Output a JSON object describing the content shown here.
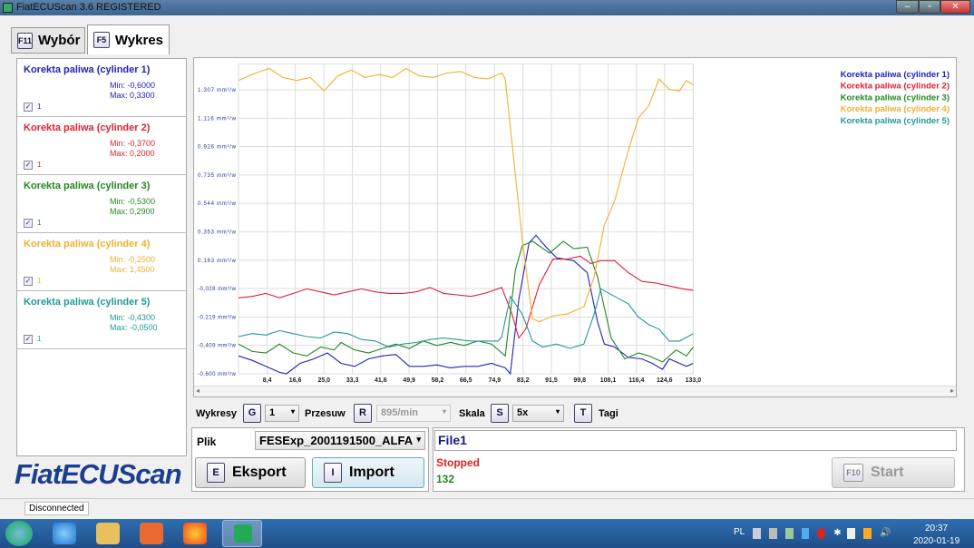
{
  "window": {
    "title": "FiatECUScan 3.6 REGISTERED"
  },
  "tabs": [
    {
      "key": "F11",
      "label": "Wybór"
    },
    {
      "key": "F5",
      "label": "Wykres"
    }
  ],
  "channels": [
    {
      "name": "Korekta paliwa (cylinder 1)",
      "min": "Min: -0,6000",
      "max": "Max: 0,3300",
      "value": "1",
      "checked": true,
      "color": "#2222bb"
    },
    {
      "name": "Korekta paliwa (cylinder 2)",
      "min": "Min: -0,3700",
      "max": "Max: 0,2000",
      "value": "1",
      "checked": true,
      "color": "#dd2233"
    },
    {
      "name": "Korekta paliwa (cylinder 3)",
      "min": "Min: -0,5300",
      "max": "Max: 0,2900",
      "value": "1",
      "checked": true,
      "color": "#228822"
    },
    {
      "name": "Korekta paliwa (cylinder 4)",
      "min": "Min: -0,2500",
      "max": "Max: 1,4500",
      "value": "1",
      "checked": true,
      "color": "#f0b030"
    },
    {
      "name": "Korekta paliwa (cylinder 5)",
      "min": "Min: -0,4300",
      "max": "Max: -0,0500",
      "value": "1",
      "checked": true,
      "color": "#229999"
    }
  ],
  "chart_data": {
    "type": "line",
    "xlim": [
      0,
      133
    ],
    "ylim": [
      -0.6,
      1.48
    ],
    "yticks": [
      1.307,
      1.116,
      0.926,
      0.735,
      0.544,
      0.353,
      0.163,
      -0.028,
      -0.219,
      -0.409,
      -0.6
    ],
    "ytick_labels": [
      "1,307 mm³/w",
      "1,116 mm³/w",
      "0,926 mm³/w",
      "0,735 mm³/w",
      "0,544 mm³/w",
      "0,353 mm³/w",
      "0,163 mm³/w",
      "-0,028 mm³/w",
      "-0,219 mm³/w",
      "-0,409 mm³/w",
      "-0,600 mm³/w"
    ],
    "xticks": [
      8.4,
      16.6,
      25.0,
      33.3,
      41.6,
      49.9,
      58.2,
      66.5,
      74.9,
      83.2,
      91.5,
      99.8,
      108.1,
      116.4,
      124.6,
      133.0
    ],
    "xtick_labels": [
      "8,4",
      "16,6",
      "25,0",
      "33,3",
      "41,6",
      "49,9",
      "58,2",
      "66,5",
      "74,9",
      "83,2",
      "91,5",
      "99,8",
      "108,1",
      "116,4",
      "124,6",
      "133,0"
    ],
    "grid": true,
    "legend": "top-right",
    "series": [
      {
        "name": "Korekta paliwa (cylinder 1)",
        "color": "#2222bb",
        "points": [
          [
            0,
            -0.48
          ],
          [
            4,
            -0.51
          ],
          [
            8,
            -0.55
          ],
          [
            12,
            -0.59
          ],
          [
            14,
            -0.6
          ],
          [
            18,
            -0.53
          ],
          [
            22,
            -0.5
          ],
          [
            26,
            -0.46
          ],
          [
            30,
            -0.53
          ],
          [
            34,
            -0.55
          ],
          [
            38,
            -0.5
          ],
          [
            42,
            -0.48
          ],
          [
            46,
            -0.47
          ],
          [
            50,
            -0.55
          ],
          [
            54,
            -0.55
          ],
          [
            58,
            -0.54
          ],
          [
            62,
            -0.56
          ],
          [
            66,
            -0.55
          ],
          [
            70,
            -0.55
          ],
          [
            74,
            -0.53
          ],
          [
            78,
            -0.56
          ],
          [
            79.5,
            -0.6
          ],
          [
            82,
            -0.1
          ],
          [
            85,
            0.28
          ],
          [
            87,
            0.33
          ],
          [
            90,
            0.25
          ],
          [
            93,
            0.18
          ],
          [
            98,
            0.16
          ],
          [
            102,
            0.08
          ],
          [
            105,
            -0.25
          ],
          [
            107,
            -0.4
          ],
          [
            110,
            -0.42
          ],
          [
            114,
            -0.49
          ],
          [
            118,
            -0.5
          ],
          [
            121,
            -0.53
          ],
          [
            124,
            -0.57
          ],
          [
            126,
            -0.5
          ],
          [
            129,
            -0.53
          ],
          [
            131,
            -0.55
          ],
          [
            133,
            -0.53
          ]
        ]
      },
      {
        "name": "Korekta paliwa (cylinder 2)",
        "color": "#dd2233",
        "points": [
          [
            0,
            -0.09
          ],
          [
            4,
            -0.08
          ],
          [
            8,
            -0.06
          ],
          [
            12,
            -0.09
          ],
          [
            16,
            -0.06
          ],
          [
            20,
            -0.03
          ],
          [
            24,
            -0.05
          ],
          [
            28,
            -0.07
          ],
          [
            32,
            -0.05
          ],
          [
            36,
            -0.03
          ],
          [
            40,
            -0.05
          ],
          [
            44,
            -0.06
          ],
          [
            48,
            -0.06
          ],
          [
            52,
            -0.05
          ],
          [
            56,
            -0.02
          ],
          [
            60,
            -0.06
          ],
          [
            64,
            -0.07
          ],
          [
            68,
            -0.08
          ],
          [
            72,
            -0.06
          ],
          [
            77,
            -0.02
          ],
          [
            80,
            -0.2
          ],
          [
            82,
            -0.36
          ],
          [
            84,
            -0.3
          ],
          [
            88,
            0.0
          ],
          [
            92,
            0.17
          ],
          [
            96,
            0.17
          ],
          [
            100,
            0.19
          ],
          [
            103,
            0.14
          ],
          [
            106,
            0.16
          ],
          [
            110,
            0.16
          ],
          [
            114,
            0.08
          ],
          [
            118,
            0.02
          ],
          [
            122,
            0.01
          ],
          [
            126,
            -0.01
          ],
          [
            130,
            -0.03
          ],
          [
            133,
            -0.04
          ]
        ]
      },
      {
        "name": "Korekta paliwa (cylinder 3)",
        "color": "#228822",
        "points": [
          [
            0,
            -0.4
          ],
          [
            4,
            -0.45
          ],
          [
            8,
            -0.46
          ],
          [
            12,
            -0.4
          ],
          [
            16,
            -0.46
          ],
          [
            20,
            -0.48
          ],
          [
            24,
            -0.42
          ],
          [
            28,
            -0.44
          ],
          [
            30,
            -0.39
          ],
          [
            34,
            -0.44
          ],
          [
            38,
            -0.46
          ],
          [
            42,
            -0.43
          ],
          [
            46,
            -0.4
          ],
          [
            50,
            -0.43
          ],
          [
            54,
            -0.38
          ],
          [
            58,
            -0.41
          ],
          [
            62,
            -0.39
          ],
          [
            66,
            -0.41
          ],
          [
            70,
            -0.38
          ],
          [
            74,
            -0.4
          ],
          [
            78,
            -0.48
          ],
          [
            81,
            0.1
          ],
          [
            83,
            0.26
          ],
          [
            86,
            0.29
          ],
          [
            91,
            0.21
          ],
          [
            95,
            0.29
          ],
          [
            98,
            0.24
          ],
          [
            102,
            0.25
          ],
          [
            105,
            0.05
          ],
          [
            109,
            -0.36
          ],
          [
            113,
            -0.5
          ],
          [
            117,
            -0.46
          ],
          [
            120,
            -0.48
          ],
          [
            124,
            -0.52
          ],
          [
            128,
            -0.44
          ],
          [
            131,
            -0.48
          ],
          [
            133,
            -0.42
          ]
        ]
      },
      {
        "name": "Korekta paliwa (cylinder 4)",
        "color": "#f0b030",
        "points": [
          [
            0,
            1.37
          ],
          [
            5,
            1.42
          ],
          [
            9,
            1.45
          ],
          [
            13,
            1.39
          ],
          [
            17,
            1.37
          ],
          [
            21,
            1.39
          ],
          [
            25,
            1.3
          ],
          [
            29,
            1.4
          ],
          [
            33,
            1.44
          ],
          [
            37,
            1.39
          ],
          [
            41,
            1.41
          ],
          [
            45,
            1.39
          ],
          [
            49,
            1.45
          ],
          [
            53,
            1.4
          ],
          [
            57,
            1.39
          ],
          [
            61,
            1.42
          ],
          [
            65,
            1.43
          ],
          [
            69,
            1.39
          ],
          [
            73,
            1.38
          ],
          [
            77,
            1.42
          ],
          [
            78,
            1.38
          ],
          [
            83,
            0.3
          ],
          [
            86,
            -0.23
          ],
          [
            88,
            -0.25
          ],
          [
            92,
            -0.21
          ],
          [
            96,
            -0.2
          ],
          [
            101,
            -0.15
          ],
          [
            104,
            0.05
          ],
          [
            107,
            0.4
          ],
          [
            110,
            0.56
          ],
          [
            114,
            0.9
          ],
          [
            117,
            1.12
          ],
          [
            120,
            1.2
          ],
          [
            123,
            1.38
          ],
          [
            126,
            1.31
          ],
          [
            129,
            1.3
          ],
          [
            131,
            1.37
          ],
          [
            133,
            1.34
          ]
        ]
      },
      {
        "name": "Korekta paliwa (cylinder 5)",
        "color": "#229999",
        "points": [
          [
            0,
            -0.35
          ],
          [
            4,
            -0.33
          ],
          [
            8,
            -0.34
          ],
          [
            12,
            -0.31
          ],
          [
            16,
            -0.33
          ],
          [
            20,
            -0.35
          ],
          [
            24,
            -0.36
          ],
          [
            28,
            -0.32
          ],
          [
            32,
            -0.33
          ],
          [
            36,
            -0.37
          ],
          [
            40,
            -0.38
          ],
          [
            44,
            -0.42
          ],
          [
            48,
            -0.4
          ],
          [
            52,
            -0.39
          ],
          [
            56,
            -0.37
          ],
          [
            60,
            -0.36
          ],
          [
            64,
            -0.37
          ],
          [
            68,
            -0.38
          ],
          [
            72,
            -0.38
          ],
          [
            76,
            -0.38
          ],
          [
            77,
            -0.35
          ],
          [
            79.5,
            -0.08
          ],
          [
            83,
            -0.2
          ],
          [
            86,
            -0.38
          ],
          [
            89,
            -0.42
          ],
          [
            93,
            -0.4
          ],
          [
            97,
            -0.43
          ],
          [
            101,
            -0.4
          ],
          [
            104,
            -0.2
          ],
          [
            106,
            -0.03
          ],
          [
            110,
            -0.08
          ],
          [
            114,
            -0.13
          ],
          [
            117,
            -0.22
          ],
          [
            120,
            -0.27
          ],
          [
            123,
            -0.3
          ],
          [
            126,
            -0.38
          ],
          [
            129,
            -0.38
          ],
          [
            133,
            -0.33
          ]
        ]
      }
    ]
  },
  "controls": {
    "wykresy_label": "Wykresy",
    "wykresy_key": "G",
    "wykresy_value": "1",
    "przesuw_label": "Przesuw",
    "przesuw_key": "R",
    "przesuw_value": "895/min",
    "skala_label": "Skala",
    "skala_key": "S",
    "skala_value": "5x",
    "tagi_key": "T",
    "tagi_label": "Tagi"
  },
  "file": {
    "label": "Plik",
    "value": "FESExp_2001191500_ALFA '",
    "export_key": "E",
    "export_label": "Eksport",
    "import_key": "I",
    "import_label": "Import"
  },
  "status": {
    "file_name": "File1",
    "state": "Stopped",
    "count": "132",
    "start_key": "F10",
    "start_label": "Start"
  },
  "logo": "FiatECUScan",
  "statusbar": {
    "connection": "Disconnected"
  },
  "taskbar": {
    "lang": "PL",
    "time": "20:37",
    "date": "2020-01-19"
  }
}
